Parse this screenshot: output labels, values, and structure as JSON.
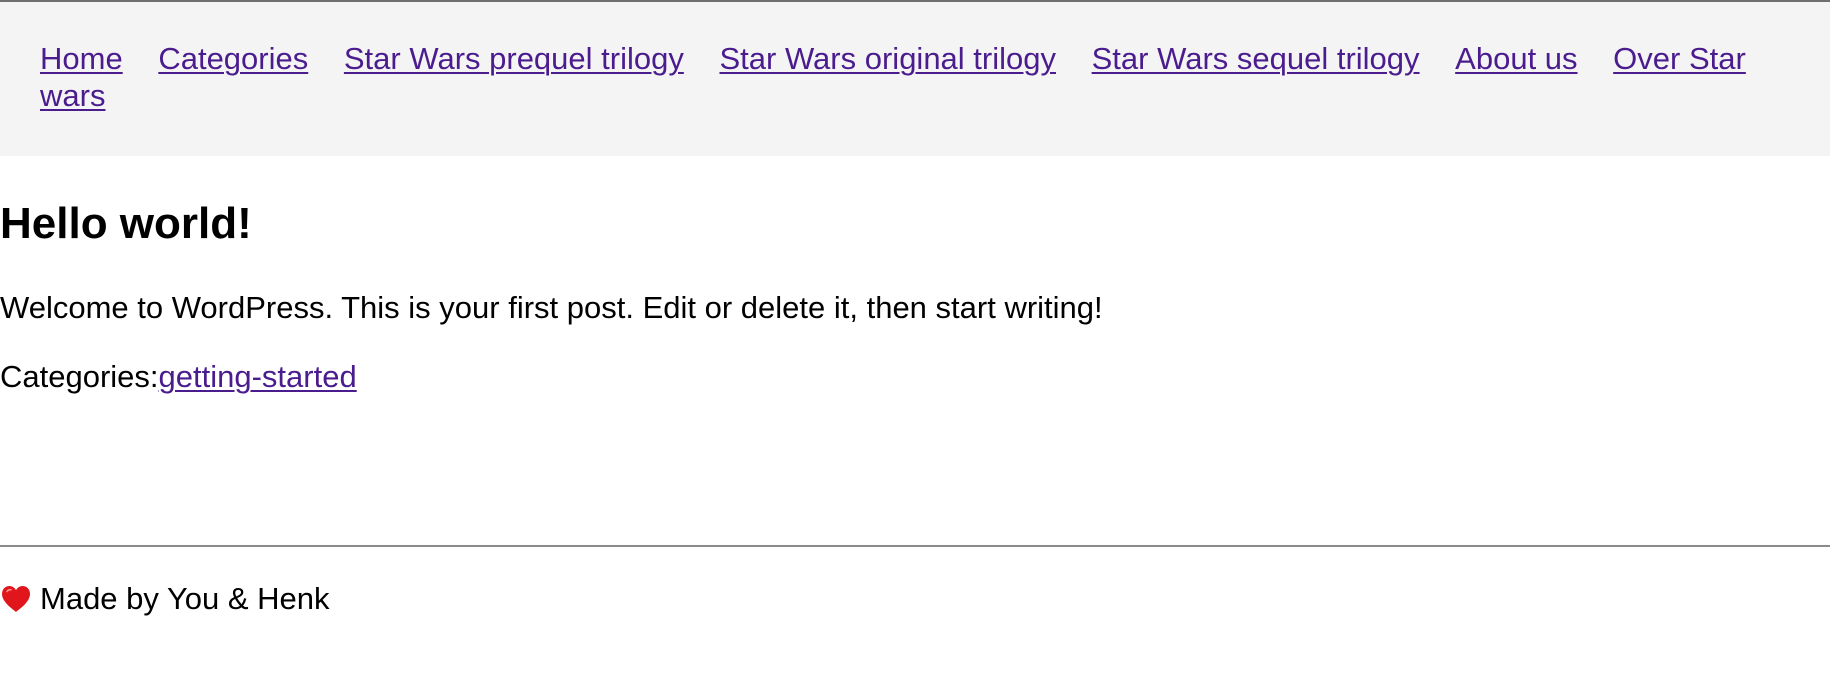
{
  "nav": {
    "items": [
      {
        "label": "Home"
      },
      {
        "label": "Categories"
      },
      {
        "label": "Star Wars prequel trilogy"
      },
      {
        "label": "Star Wars original trilogy"
      },
      {
        "label": "Star Wars sequel trilogy"
      },
      {
        "label": "About us"
      },
      {
        "label": "Over Star wars"
      }
    ]
  },
  "post": {
    "title": "Hello world!",
    "body": "Welcome to WordPress. This is your first post. Edit or delete it, then start writing!",
    "categories_label": "Categories:",
    "category_link": "getting-started"
  },
  "footer": {
    "icon": "heart-icon",
    "text": "Made by You & Henk"
  },
  "colors": {
    "link": "#4b1c8e",
    "nav_background": "#f4f4f4",
    "heart": "#e0161c"
  }
}
